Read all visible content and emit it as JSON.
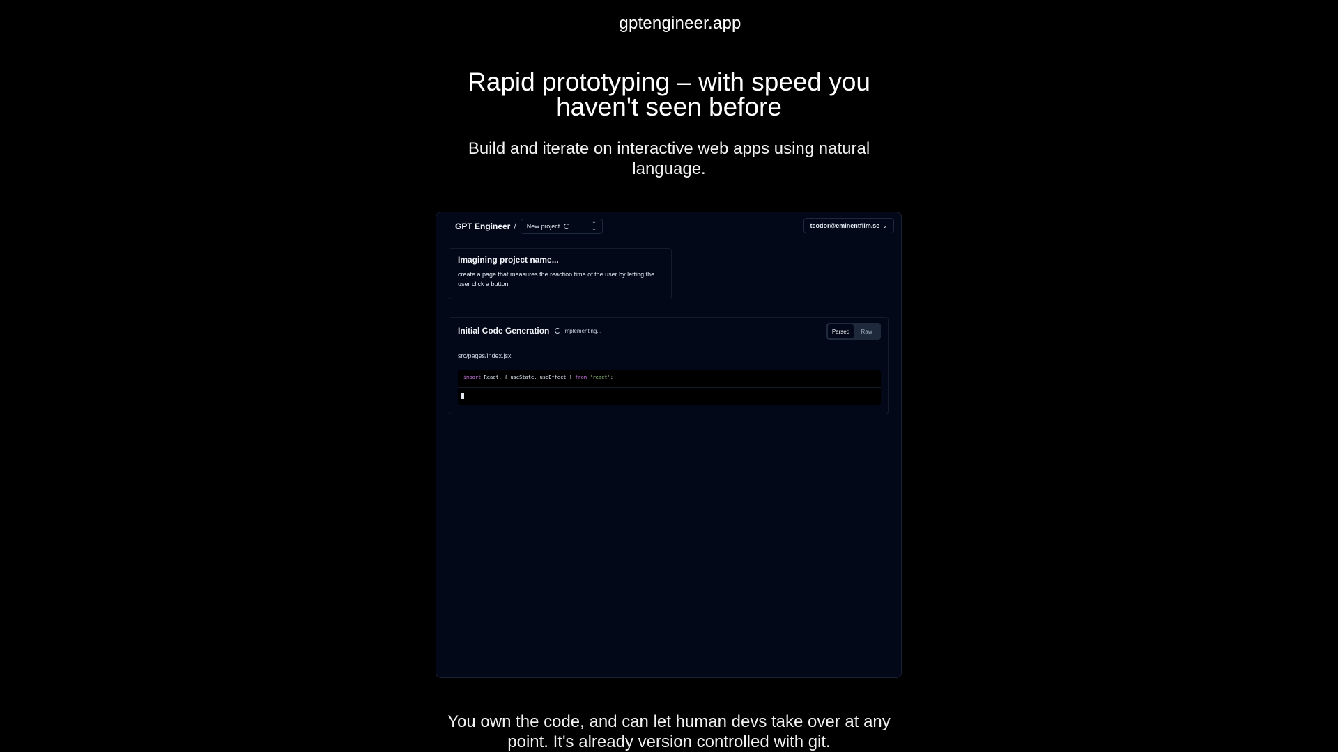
{
  "brand": "gptengineer.app",
  "hero": {
    "title": "Rapid prototyping – with speed you haven't seen before",
    "subtitle": "Build and iterate on interactive web apps using natural language."
  },
  "app": {
    "name": "GPT Engineer",
    "crumb_separator": "/",
    "project_name": "New project",
    "user_email": "teodor@eminentfilm.se",
    "prompt_card": {
      "title": "Imagining project name...",
      "text": "create a page that measures the reaction time of the user by letting the user click a button"
    },
    "generation": {
      "title": "Initial Code Generation",
      "status": "Implementing...",
      "toggle": {
        "parsed": "Parsed",
        "raw": "Raw",
        "selected": "Parsed"
      },
      "file_path": "src/pages/index.jsx",
      "code": {
        "kw_import": "import",
        "body": " React, { useState, useEffect } ",
        "kw_from": "from",
        "string": "'react'",
        "end": ";"
      }
    },
    "icons": {
      "project_status": "spinner-icon",
      "project_select": "chevron-up-down-icon",
      "user_menu": "chevron-down-icon",
      "generation_status": "spinner-icon",
      "editor_cursor": "text-cursor-icon"
    }
  },
  "footer": {
    "text": "You own the code, and can let human devs take over at any point. It's already version controlled with git."
  },
  "colors": {
    "page_background": "#000000",
    "app_background": "#020817",
    "border": "#1e293b",
    "keyword": "#c678dd",
    "string": "#98c379"
  }
}
